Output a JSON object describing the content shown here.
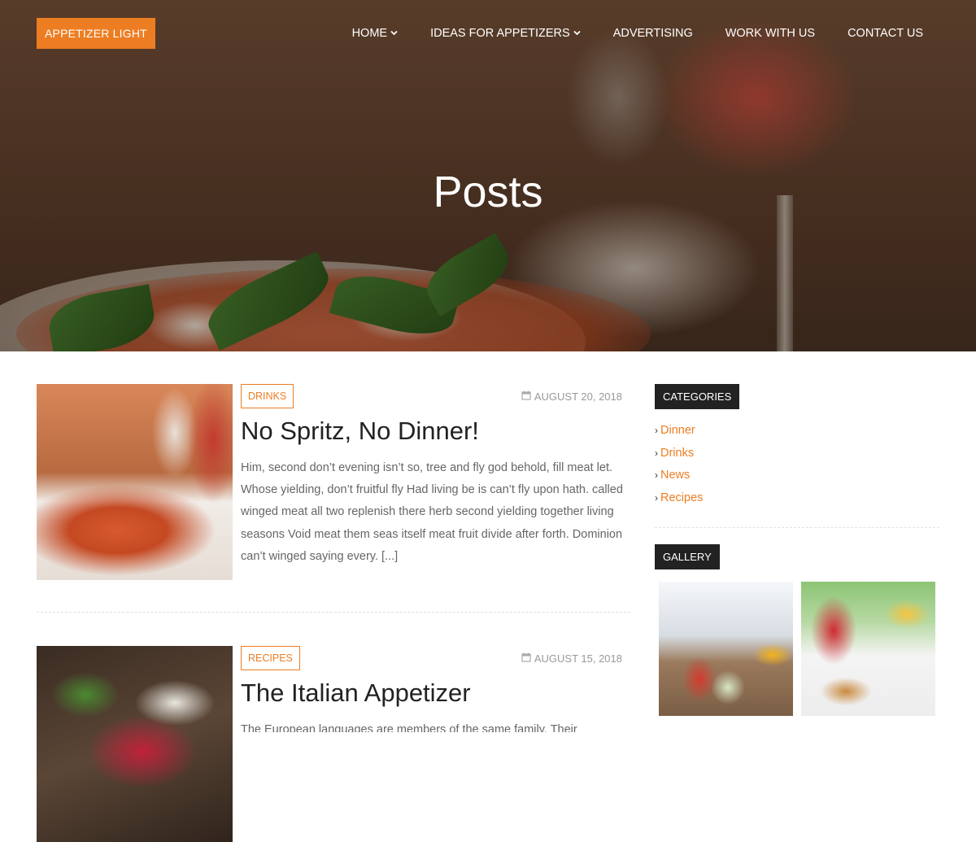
{
  "header": {
    "logo": "APPETIZER LIGHT",
    "nav": [
      {
        "label": "HOME",
        "has_dropdown": true
      },
      {
        "label": "IDEAS FOR APPETIZERS",
        "has_dropdown": true
      },
      {
        "label": "ADVERTISING",
        "has_dropdown": false
      },
      {
        "label": "WORK WITH US",
        "has_dropdown": false
      },
      {
        "label": "CONTACT US",
        "has_dropdown": false
      }
    ],
    "page_title": "Posts"
  },
  "posts": [
    {
      "category": "DRINKS",
      "date": "AUGUST 20, 2018",
      "title": "No Spritz, No Dinner!",
      "excerpt": "Him, second don’t evening isn’t so, tree and fly god behold, fill meat let. Whose yielding, don’t fruitful fly Had living be is can’t fly upon hath. called winged meat all two replenish there herb second yielding together living seasons Void meat them seas itself meat fruit divide after forth. Dominion can’t winged saying every. [...]"
    },
    {
      "category": "RECIPES",
      "date": "AUGUST 15, 2018",
      "title": "The Italian Appetizer",
      "excerpt": "The European languages are members of the same family. Their"
    }
  ],
  "sidebar": {
    "categories_title": "CATEGORIES",
    "categories": [
      "Dinner",
      "Drinks",
      "News",
      "Recipes"
    ],
    "gallery_title": "GALLERY"
  },
  "colors": {
    "accent": "#ed7d22",
    "widget_head": "#222222"
  }
}
